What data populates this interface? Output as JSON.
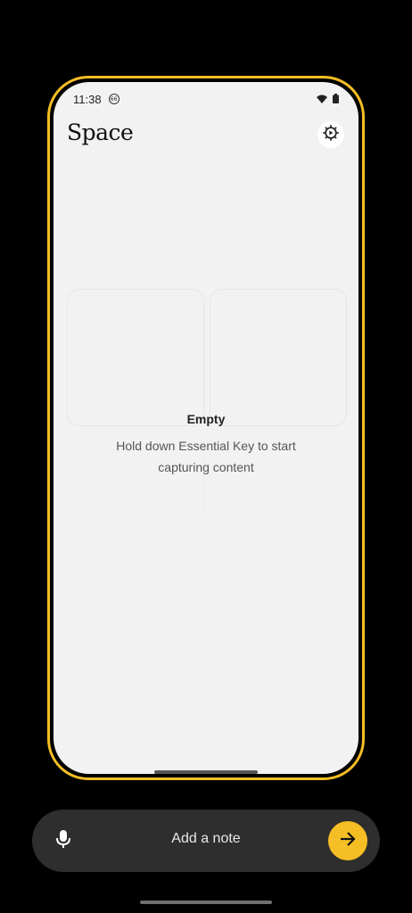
{
  "status_bar": {
    "time": "11:38",
    "notification_count": "66",
    "icons": [
      "wifi-icon",
      "battery-icon"
    ]
  },
  "app": {
    "title": "Space",
    "settings_icon": "gear-icon"
  },
  "empty_state": {
    "title": "Empty",
    "description": "Hold down Essential Key to start capturing content"
  },
  "note_bar": {
    "placeholder": "Add a note",
    "mic_icon": "microphone-icon",
    "send_icon": "arrow-right-icon"
  },
  "colors": {
    "accent": "#F5BE24",
    "screen_bg": "#F2F2F2",
    "bar_bg": "#2E2E2E",
    "page_bg": "#000000"
  }
}
